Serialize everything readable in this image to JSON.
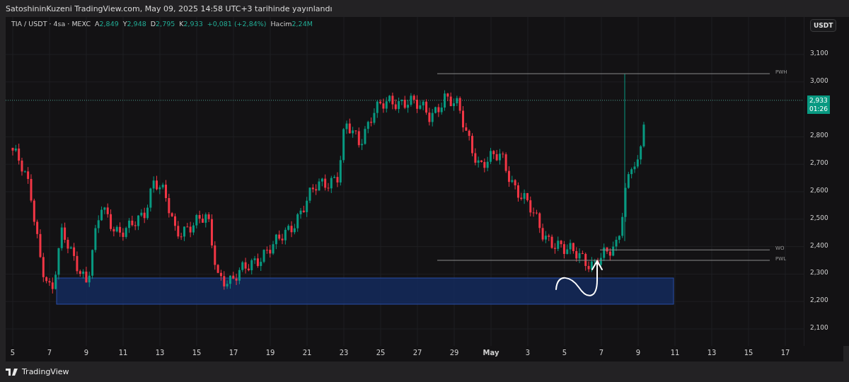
{
  "header": {
    "attribution": "SatoshininKuzeni TradingView.com, May 09, 2025 14:58 UTC+3 tarihinde yayınlandı"
  },
  "legend": {
    "symbol": "TIA / USDT · 4sa · MEXC",
    "values": [
      {
        "label": "A",
        "value": "2,849"
      },
      {
        "label": "Y",
        "value": "2,948"
      },
      {
        "label": "D",
        "value": "2,795"
      },
      {
        "label": "K",
        "value": "2,933"
      }
    ],
    "change": "+0,081 (+2,84%)",
    "volume_label": "Hacim",
    "volume": "2,24M"
  },
  "currency_button": "USDT",
  "price_axis": [
    "3,100",
    "3,000",
    "2,800",
    "2,700",
    "2,600",
    "2,500",
    "2,400",
    "2,300",
    "2,200",
    "2,100"
  ],
  "last_price": {
    "price": "2,933",
    "countdown": "01:26"
  },
  "levels": [
    {
      "label": "PWH"
    },
    {
      "label": "WO"
    },
    {
      "label": "PWL"
    }
  ],
  "time_axis": [
    {
      "label": "5",
      "bold": false
    },
    {
      "label": "7",
      "bold": false
    },
    {
      "label": "9",
      "bold": false
    },
    {
      "label": "11",
      "bold": false
    },
    {
      "label": "13",
      "bold": false
    },
    {
      "label": "15",
      "bold": false
    },
    {
      "label": "17",
      "bold": false
    },
    {
      "label": "19",
      "bold": false
    },
    {
      "label": "21",
      "bold": false
    },
    {
      "label": "23",
      "bold": false
    },
    {
      "label": "25",
      "bold": false
    },
    {
      "label": "27",
      "bold": false
    },
    {
      "label": "29",
      "bold": false
    },
    {
      "label": "May",
      "bold": true
    },
    {
      "label": "3",
      "bold": false
    },
    {
      "label": "5",
      "bold": false
    },
    {
      "label": "7",
      "bold": false
    },
    {
      "label": "9",
      "bold": false
    },
    {
      "label": "11",
      "bold": false
    },
    {
      "label": "13",
      "bold": false
    },
    {
      "label": "15",
      "bold": false
    },
    {
      "label": "17",
      "bold": false
    }
  ],
  "footer": {
    "logo_text": "TradingView"
  }
}
